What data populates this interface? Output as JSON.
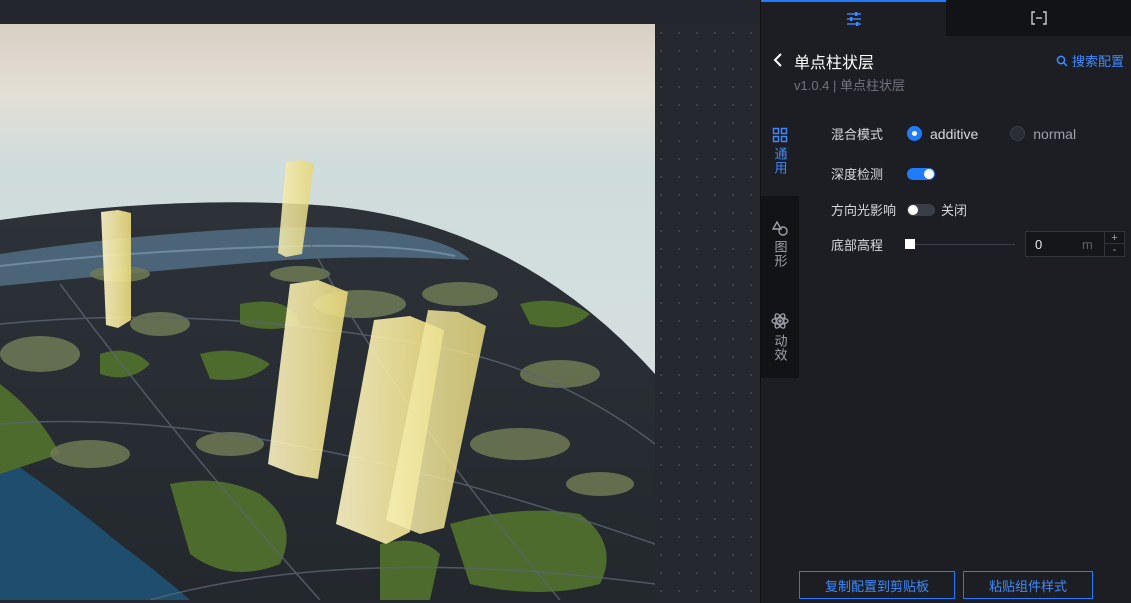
{
  "panel": {
    "tabs": [
      {
        "name": "settings-sliders-icon"
      },
      {
        "name": "bracket-minus-icon"
      }
    ],
    "title": "单点柱状层",
    "subtitle": "v1.0.4 | 单点柱状层",
    "search_label": "搜索配置",
    "side_nav": [
      {
        "label": "通用",
        "icon": "grid-icon",
        "active": true
      },
      {
        "label": "图形",
        "icon": "shapes-icon",
        "active": false
      },
      {
        "label": "动效",
        "icon": "atom-icon",
        "active": false
      }
    ],
    "fields": {
      "blend": {
        "label": "混合模式",
        "options": [
          "additive",
          "normal"
        ],
        "selected": "additive"
      },
      "depth": {
        "label": "深度检测",
        "on": true
      },
      "light": {
        "label": "方向光影响",
        "on": false,
        "state_text": "关闭"
      },
      "height": {
        "label": "底部高程",
        "value": "0",
        "unit": "m",
        "plus": "+",
        "minus": "-"
      }
    },
    "buttons": {
      "copy": "复制配置到剪贴板",
      "paste": "粘贴组件样式"
    }
  },
  "colors": {
    "accent": "#1f7cff",
    "link": "#3d8bff",
    "panel_bg": "#1c1e23"
  }
}
